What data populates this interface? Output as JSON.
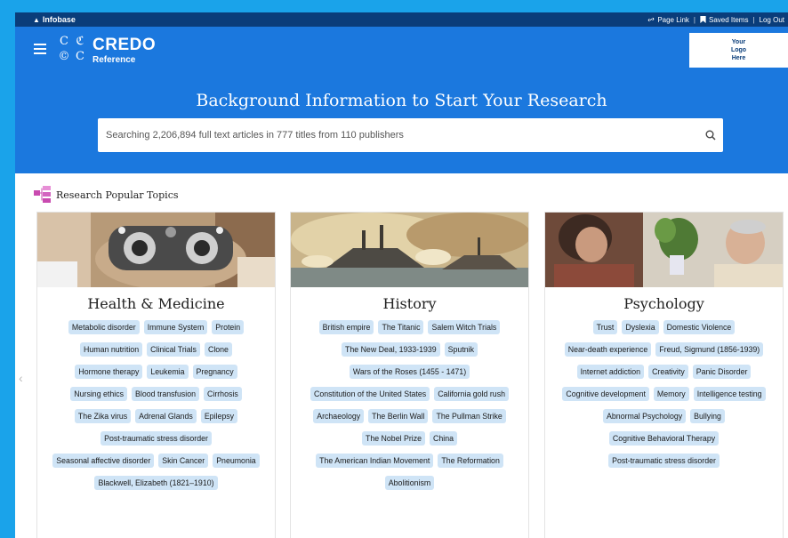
{
  "topbar": {
    "brand": "Infobase",
    "links": [
      {
        "label": "Page Link",
        "icon": "link-icon"
      },
      {
        "label": "Saved Items",
        "icon": "bookmark-icon"
      },
      {
        "label": "Log Out",
        "icon": ""
      }
    ]
  },
  "header": {
    "logo_name": "CREDO",
    "logo_sub": "Reference",
    "logo_box": [
      "Your",
      "Logo",
      "Here"
    ],
    "hero_title": "Background Information to Start Your Research",
    "search_placeholder": "Searching 2,206,894 full text articles in 777 titles from 110 publishers"
  },
  "section": {
    "title": "Research Popular Topics",
    "icon": "topics-grid-icon"
  },
  "cards": [
    {
      "title": "Health & Medicine",
      "image": "eye-exam-photo",
      "tags": [
        "Metabolic disorder",
        "Immune System",
        "Protein",
        "Human nutrition",
        "Clinical Trials",
        "Clone",
        "Hormone therapy",
        "Leukemia",
        "Pregnancy",
        "Nursing ethics",
        "Blood transfusion",
        "Cirrhosis",
        "The Zika virus",
        "Adrenal Glands",
        "Epilepsy",
        "Post-traumatic stress disorder",
        "Seasonal affective disorder",
        "Skin Cancer",
        "Pneumonia",
        "Blackwell, Elizabeth (1821–1910)"
      ]
    },
    {
      "title": "History",
      "image": "naval-battle-painting",
      "tags": [
        "British empire",
        "The Titanic",
        "Salem Witch Trials",
        "The New Deal, 1933-1939",
        "Sputnik",
        "Wars of the Roses (1455 - 1471)",
        "Constitution of the United States",
        "California gold rush",
        "Archaeology",
        "The Berlin Wall",
        "The Pullman Strike",
        "The Nobel Prize",
        "China",
        "The American Indian Movement",
        "The Reformation",
        "Abolitionism"
      ]
    },
    {
      "title": "Psychology",
      "image": "counseling-session-photo",
      "tags": [
        "Trust",
        "Dyslexia",
        "Domestic Violence",
        "Near-death experience",
        "Freud, Sigmund (1856-1939)",
        "Internet addiction",
        "Creativity",
        "Panic Disorder",
        "Cognitive development",
        "Memory",
        "Intelligence testing",
        "Abnormal Psychology",
        "Bullying",
        "Cognitive Behavioral Therapy",
        "Post-traumatic stress disorder"
      ]
    }
  ],
  "colors": {
    "header": "#1b78de",
    "topbar": "#0a3d7a",
    "frame": "#1aa3ea",
    "tag_bg": "#cfe4f6"
  }
}
